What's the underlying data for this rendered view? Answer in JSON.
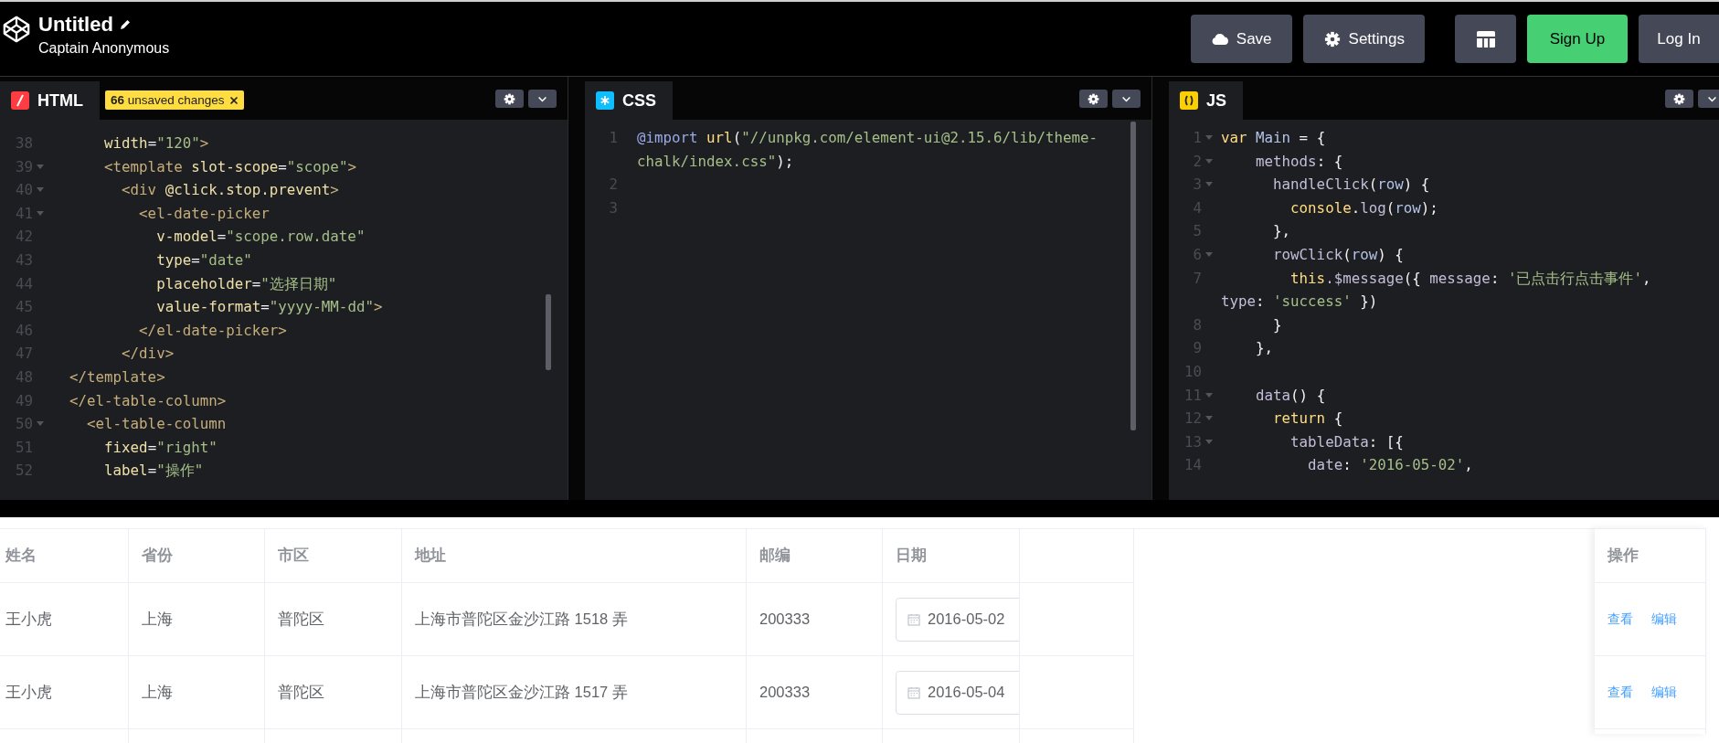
{
  "header": {
    "title": "Untitled",
    "author": "Captain Anonymous",
    "buttons": [
      {
        "kind": "save",
        "label": "Save"
      },
      {
        "kind": "settings",
        "label": "Settings"
      },
      {
        "kind": "layout"
      },
      {
        "kind": "signup",
        "label": "Sign Up"
      },
      {
        "kind": "login",
        "label": "Log In"
      }
    ]
  },
  "panels": [
    {
      "kind": "html",
      "name": "HTML",
      "badge": {
        "text": "**66** unsaved changes"
      },
      "lines": [
        {
          "number": "38",
          "fold": false,
          "segments": [
            {
              "text": "      width",
              "kind": "attr"
            },
            {
              "text": "=",
              "kind": "punc"
            },
            {
              "text": "\"120\"",
              "kind": "str"
            },
            {
              "text": ">",
              "kind": "tag"
            }
          ]
        },
        {
          "number": "39",
          "fold": true,
          "segments": [
            {
              "text": "      <template",
              "kind": "tag"
            },
            {
              "text": " slot-scope",
              "kind": "attr"
            },
            {
              "text": "=",
              "kind": "punc"
            },
            {
              "text": "\"scope\"",
              "kind": "str"
            },
            {
              "text": ">",
              "kind": "tag"
            }
          ]
        },
        {
          "number": "40",
          "fold": true,
          "segments": [
            {
              "text": "        <div",
              "kind": "tag"
            },
            {
              "text": " @click.stop.prevent",
              "kind": "attr"
            },
            {
              "text": ">",
              "kind": "tag"
            }
          ]
        },
        {
          "number": "41",
          "fold": true,
          "segments": [
            {
              "text": "          <el-date-picker",
              "kind": "tag"
            }
          ]
        },
        {
          "number": "42",
          "fold": false,
          "segments": [
            {
              "text": "            v-model",
              "kind": "attr"
            },
            {
              "text": "=",
              "kind": "punc"
            },
            {
              "text": "\"scope.row.date\"",
              "kind": "str"
            }
          ]
        },
        {
          "number": "43",
          "fold": false,
          "segments": [
            {
              "text": "            type",
              "kind": "attr"
            },
            {
              "text": "=",
              "kind": "punc"
            },
            {
              "text": "\"date\"",
              "kind": "str"
            }
          ]
        },
        {
          "number": "44",
          "fold": false,
          "segments": [
            {
              "text": "            placeholder",
              "kind": "attr"
            },
            {
              "text": "=",
              "kind": "punc"
            },
            {
              "text": "\"选择日期\"",
              "kind": "str"
            }
          ]
        },
        {
          "number": "45",
          "fold": false,
          "segments": [
            {
              "text": "            value-format",
              "kind": "attr"
            },
            {
              "text": "=",
              "kind": "punc"
            },
            {
              "text": "\"yyyy-MM-dd\"",
              "kind": "str"
            },
            {
              "text": ">",
              "kind": "tag"
            }
          ]
        },
        {
          "number": "46",
          "fold": false,
          "segments": [
            {
              "text": "          </el-date-picker>",
              "kind": "tag"
            }
          ]
        },
        {
          "number": "47",
          "fold": false,
          "segments": [
            {
              "text": "        </div>",
              "kind": "tag"
            }
          ]
        },
        {
          "number": "48",
          "fold": false,
          "segments": [
            {
              "text": "  </template>",
              "kind": "tag"
            }
          ]
        },
        {
          "number": "49",
          "fold": false,
          "segments": [
            {
              "text": "  </el-table-column>",
              "kind": "tag"
            }
          ]
        },
        {
          "number": "50",
          "fold": true,
          "segments": [
            {
              "text": "    <el-table-column",
              "kind": "tag"
            }
          ]
        },
        {
          "number": "51",
          "fold": false,
          "segments": [
            {
              "text": "      fixed",
              "kind": "attr"
            },
            {
              "text": "=",
              "kind": "punc"
            },
            {
              "text": "\"right\"",
              "kind": "str"
            }
          ]
        },
        {
          "number": "52",
          "fold": false,
          "segments": [
            {
              "text": "      label",
              "kind": "attr"
            },
            {
              "text": "=",
              "kind": "punc"
            },
            {
              "text": "\"操作\"",
              "kind": "str"
            }
          ]
        }
      ]
    },
    {
      "kind": "css",
      "name": "CSS",
      "lines": [
        {
          "number": "1",
          "fold": false,
          "segments": [
            {
              "text": "@import",
              "kind": "at"
            },
            {
              "text": " url",
              "kind": "kw"
            },
            {
              "text": "(",
              "kind": "punc"
            },
            {
              "text": "\"//unpkg.com/element-ui@2.15.6/lib/theme-",
              "kind": "str"
            }
          ],
          "wrap": [
            {
              "text": "chalk/index.css\"",
              "kind": "str"
            },
            {
              "text": ");",
              "kind": "punc"
            }
          ]
        },
        {
          "number": "2",
          "fold": false
        },
        {
          "number": "3",
          "fold": false
        }
      ]
    },
    {
      "kind": "js",
      "name": "JS",
      "lines": [
        {
          "number": "1",
          "fold": true,
          "segments": [
            {
              "text": "var",
              "kind": "kw"
            },
            {
              "text": " Main",
              "kind": "def"
            },
            {
              "text": " = {",
              "kind": "punc"
            }
          ]
        },
        {
          "number": "2",
          "fold": true,
          "segments": [
            {
              "text": "    methods",
              "kind": "prop"
            },
            {
              "text": ": {",
              "kind": "punc"
            }
          ]
        },
        {
          "number": "3",
          "fold": true,
          "segments": [
            {
              "text": "      handleClick",
              "kind": "prop"
            },
            {
              "text": "(",
              "kind": "punc"
            },
            {
              "text": "row",
              "kind": "def"
            },
            {
              "text": ") {",
              "kind": "punc"
            }
          ]
        },
        {
          "number": "4",
          "fold": false,
          "segments": [
            {
              "text": "        console",
              "kind": "kw"
            },
            {
              "text": ".",
              "kind": "punc"
            },
            {
              "text": "log",
              "kind": "prop"
            },
            {
              "text": "(",
              "kind": "punc"
            },
            {
              "text": "row",
              "kind": "def"
            },
            {
              "text": ");",
              "kind": "punc"
            }
          ]
        },
        {
          "number": "5",
          "fold": false,
          "segments": [
            {
              "text": "      },",
              "kind": "punc"
            }
          ]
        },
        {
          "number": "6",
          "fold": true,
          "segments": [
            {
              "text": "      rowClick",
              "kind": "prop"
            },
            {
              "text": "(",
              "kind": "punc"
            },
            {
              "text": "row",
              "kind": "def"
            },
            {
              "text": ") {",
              "kind": "punc"
            }
          ]
        },
        {
          "number": "7",
          "fold": false,
          "segments": [
            {
              "text": "        this",
              "kind": "kw"
            },
            {
              "text": ".$message",
              "kind": "prop"
            },
            {
              "text": "({ ",
              "kind": "punc"
            },
            {
              "text": "message",
              "kind": "prop"
            },
            {
              "text": ": ",
              "kind": "punc"
            },
            {
              "text": "'已点击行点击事件'",
              "kind": "str"
            },
            {
              "text": ",",
              "kind": "punc"
            }
          ],
          "wrap": [
            {
              "text": "type",
              "kind": "prop"
            },
            {
              "text": ": ",
              "kind": "punc"
            },
            {
              "text": "'success'",
              "kind": "str"
            },
            {
              "text": " })",
              "kind": "punc"
            }
          ]
        },
        {
          "number": "8",
          "fold": false,
          "segments": [
            {
              "text": "      }",
              "kind": "punc"
            }
          ]
        },
        {
          "number": "9",
          "fold": false,
          "segments": [
            {
              "text": "    },",
              "kind": "punc"
            }
          ]
        },
        {
          "number": "10",
          "fold": false
        },
        {
          "number": "11",
          "fold": true,
          "segments": [
            {
              "text": "    data",
              "kind": "prop"
            },
            {
              "text": "() {",
              "kind": "punc"
            }
          ]
        },
        {
          "number": "12",
          "fold": true,
          "segments": [
            {
              "text": "      return",
              "kind": "kw"
            },
            {
              "text": " {",
              "kind": "punc"
            }
          ]
        },
        {
          "number": "13",
          "fold": true,
          "segments": [
            {
              "text": "        tableData",
              "kind": "prop"
            },
            {
              "text": ": [{",
              "kind": "punc"
            }
          ]
        },
        {
          "number": "14",
          "fold": false,
          "segments": [
            {
              "text": "          date",
              "kind": "prop"
            },
            {
              "text": ": ",
              "kind": "punc"
            },
            {
              "text": "'2016-05-02'",
              "kind": "str"
            },
            {
              "text": ",",
              "kind": "punc"
            }
          ]
        }
      ]
    }
  ],
  "table": {
    "columns": [
      "姓名",
      "省份",
      "市区",
      "地址",
      "邮编",
      "日期"
    ],
    "action_column": "操作",
    "rows": [
      {
        "cells": [
          "王小虎",
          "上海",
          "普陀区",
          "上海市普陀区金沙江路 1518 弄",
          "200333"
        ],
        "date": "2016-05-02",
        "actions": [
          "查看",
          "编辑"
        ]
      },
      {
        "cells": [
          "王小虎",
          "上海",
          "普陀区",
          "上海市普陀区金沙江路 1517 弄",
          "200333"
        ],
        "date": "2016-05-04",
        "actions": [
          "查看",
          "编辑"
        ]
      }
    ]
  }
}
